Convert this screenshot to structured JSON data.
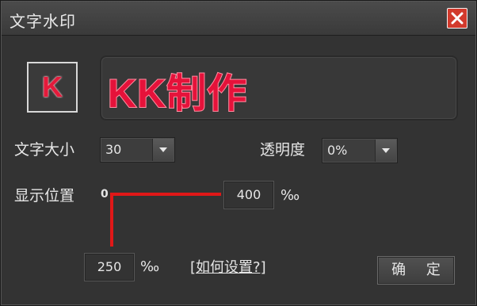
{
  "window": {
    "title": "文字水印"
  },
  "preview": {
    "icon_letter": "K",
    "text": "KK制作",
    "text_color": "#e5123a"
  },
  "font_size": {
    "label": "文字大小",
    "value": "30"
  },
  "opacity": {
    "label": "透明度",
    "value": "0%"
  },
  "position": {
    "label": "显示位置",
    "origin": "0",
    "x_value": "400",
    "y_value": "250",
    "unit": "‰",
    "line_color": "#e01818"
  },
  "help_link": "[如何设置?]",
  "ok_button": "确 定",
  "icons": {
    "close": "close-icon",
    "dropdown": "chevron-down-icon"
  }
}
